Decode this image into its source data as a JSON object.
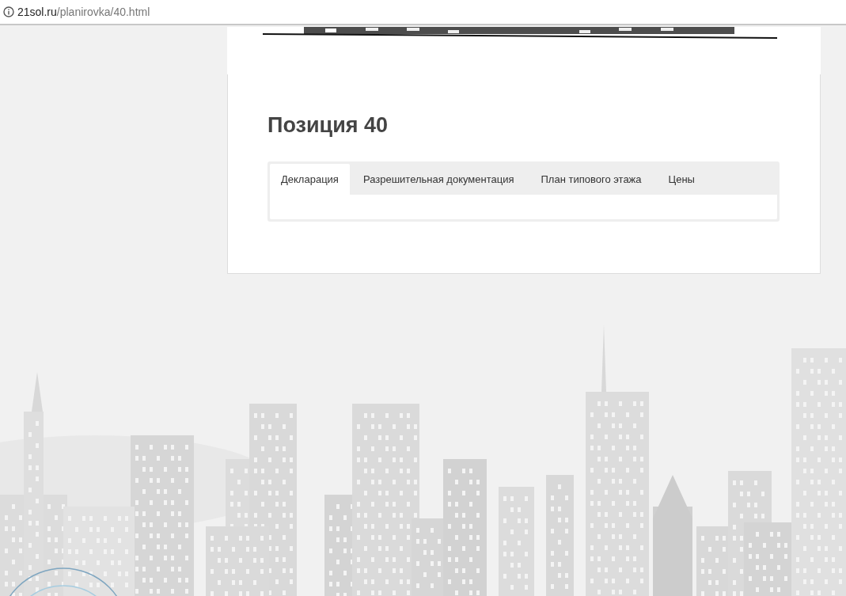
{
  "address_bar": {
    "host": "21sol.ru",
    "path": "/planirovka/40.html"
  },
  "heading": "Позиция 40",
  "tabs": [
    {
      "label": "Декларация",
      "selected": true
    },
    {
      "label": "Разрешительная документация",
      "selected": false
    },
    {
      "label": "План типового этажа",
      "selected": false
    },
    {
      "label": "Цены",
      "selected": false
    }
  ]
}
